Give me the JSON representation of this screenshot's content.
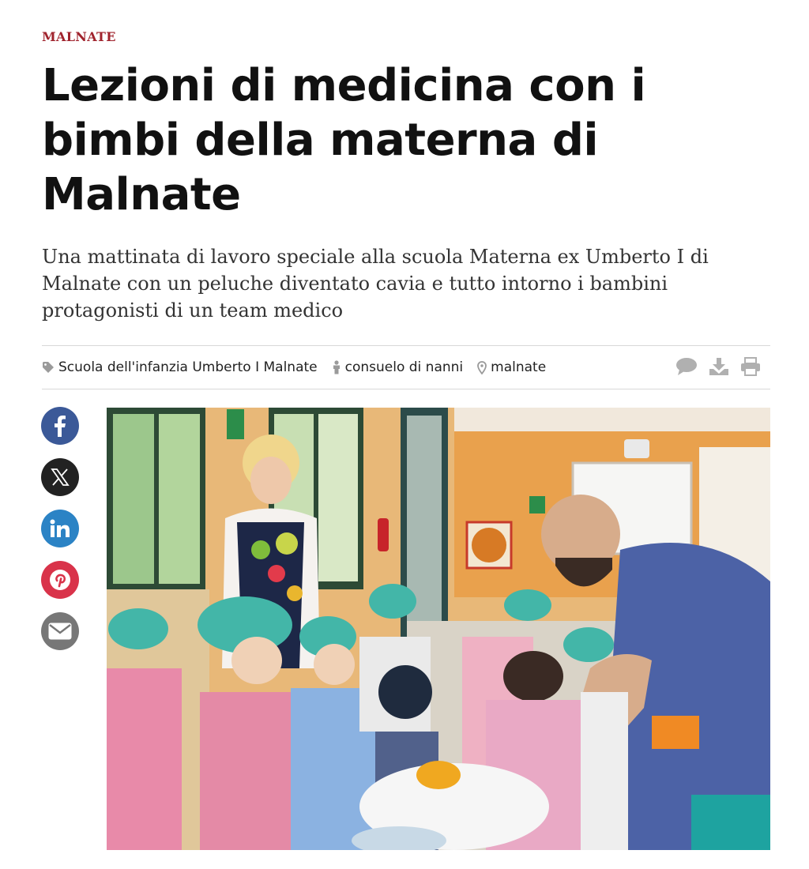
{
  "article": {
    "category": "MALNATE",
    "headline": "Lezioni di medicina con i bimbi della materna di Malnate",
    "subtitle": "Una mattinata di lavoro speciale alla scuola Materna ex Umberto I di Malnate con un peluche diventato cavia e tutto intorno i bambini protagonisti di un team medico"
  },
  "meta": {
    "tag": "Scuola dell'infanzia Umberto I Malnate",
    "author": "consuelo di nanni",
    "location": "malnate",
    "icons": [
      "tag-icon",
      "person-icon",
      "location-pin-icon",
      "comment-icon",
      "download-icon",
      "print-icon"
    ]
  },
  "share": {
    "buttons": [
      {
        "icon": "facebook-icon",
        "color": "#3b5998"
      },
      {
        "icon": "x-icon",
        "color": "#222222"
      },
      {
        "icon": "linkedin-icon",
        "color": "#2b83c5"
      },
      {
        "icon": "pinterest-icon",
        "color": "#d9334a"
      },
      {
        "icon": "mail-icon",
        "color": "#777777"
      }
    ]
  },
  "colors": {
    "accent": "#a0232d",
    "meta_icon": "#999999"
  }
}
